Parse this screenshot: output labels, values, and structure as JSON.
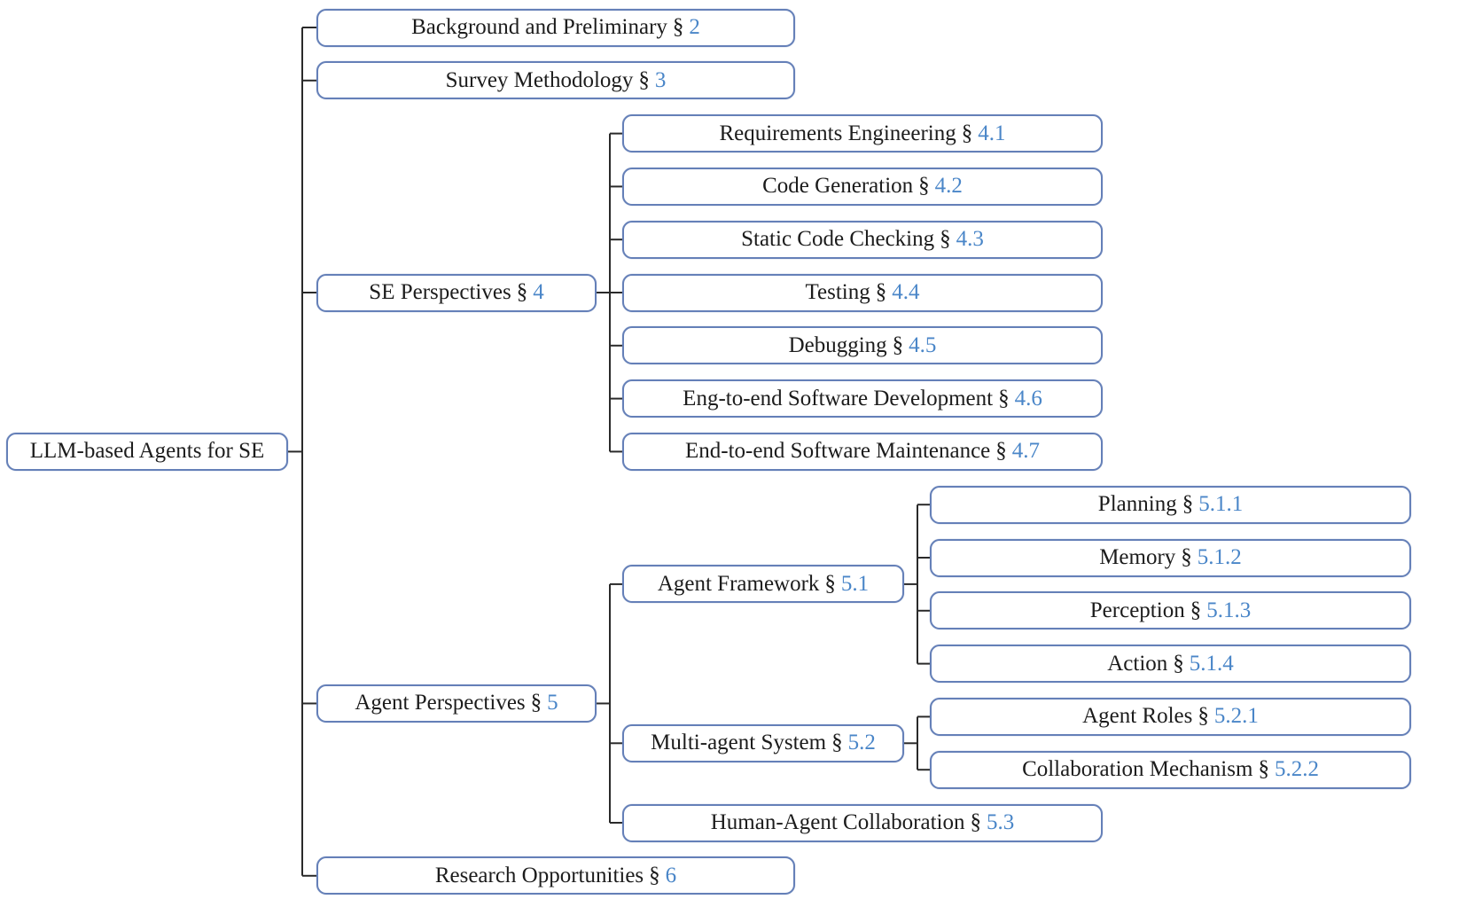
{
  "section_symbol": "§",
  "colors": {
    "border": "#6580b8",
    "section_number": "#4a86c8",
    "text": "#1c1c1c",
    "edge": "#2a2a2a"
  },
  "root": {
    "label": "LLM-based Agents for SE",
    "children": [
      {
        "label": "Background and Preliminary",
        "section": "2"
      },
      {
        "label": "Survey Methodology",
        "section": "3"
      },
      {
        "label": "SE Perspectives",
        "section": "4",
        "children": [
          {
            "label": "Requirements Engineering",
            "section": "4.1"
          },
          {
            "label": "Code Generation",
            "section": "4.2"
          },
          {
            "label": "Static Code Checking",
            "section": "4.3"
          },
          {
            "label": "Testing",
            "section": "4.4"
          },
          {
            "label": "Debugging",
            "section": "4.5"
          },
          {
            "label": "Eng-to-end Software Development",
            "section": "4.6"
          },
          {
            "label": "End-to-end Software Maintenance",
            "section": "4.7"
          }
        ]
      },
      {
        "label": "Agent Perspectives",
        "section": "5",
        "children": [
          {
            "label": "Agent Framework",
            "section": "5.1",
            "children": [
              {
                "label": "Planning",
                "section": "5.1.1"
              },
              {
                "label": "Memory",
                "section": "5.1.2"
              },
              {
                "label": "Perception",
                "section": "5.1.3"
              },
              {
                "label": "Action",
                "section": "5.1.4"
              }
            ]
          },
          {
            "label": "Multi-agent System",
            "section": "5.2",
            "children": [
              {
                "label": "Agent Roles",
                "section": "5.2.1"
              },
              {
                "label": "Collaboration Mechanism",
                "section": "5.2.2"
              }
            ]
          },
          {
            "label": "Human-Agent Collaboration",
            "section": "5.3"
          }
        ]
      },
      {
        "label": "Research Opportunities",
        "section": "6"
      }
    ]
  }
}
